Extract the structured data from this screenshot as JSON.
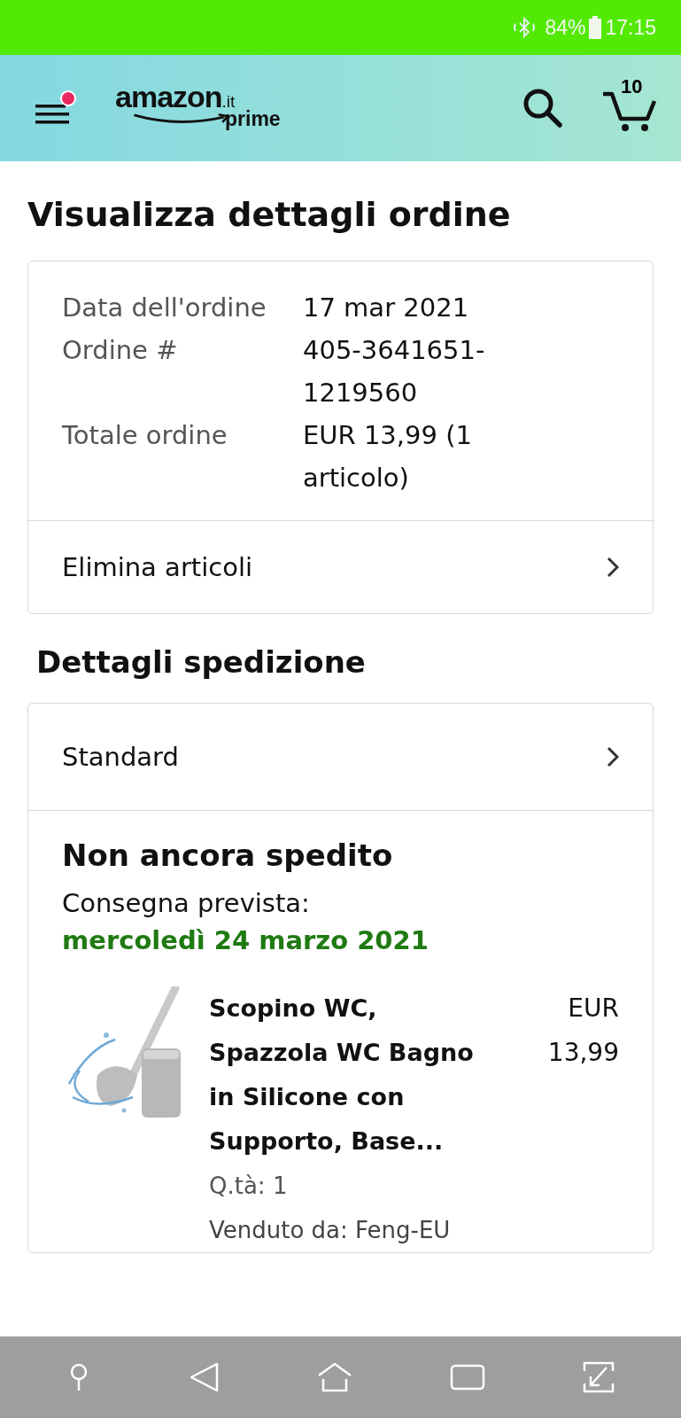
{
  "status_bar": {
    "battery": "84%",
    "time": "17:15"
  },
  "header": {
    "menu_notification": true,
    "logo": {
      "word": "amazon",
      "domain": ".it",
      "tier": "prime"
    },
    "cart_count": "10"
  },
  "title": "Visualizza dettagli ordine",
  "order_summary": {
    "fields": [
      {
        "label": "Data dell'ordine",
        "value": "17 mar 2021"
      },
      {
        "label": "Ordine #",
        "value": "405-3641651-1219560"
      },
      {
        "label": "Totale ordine",
        "value": "EUR 13,99 (1 articolo)"
      }
    ],
    "link": "Elimina articoli"
  },
  "shipping": {
    "heading": "Dettagli spedizione",
    "method": "Standard",
    "status": "Non ancora spedito",
    "delivery_label": "Consegna prevista:",
    "delivery_date": "mercoledì 24 marzo 2021",
    "item": {
      "name": "Scopino WC, Spazzola WC Bagno in Silicone con Supporto, Base...",
      "price": "EUR 13,99",
      "quantity": "Q.tà: 1",
      "seller": "Venduto da: Feng-EU"
    }
  },
  "nav_bar": {
    "buttons": [
      {
        "kind": "pin"
      },
      {
        "kind": "back"
      },
      {
        "kind": "home"
      },
      {
        "kind": "recents"
      },
      {
        "kind": "expand"
      }
    ]
  }
}
